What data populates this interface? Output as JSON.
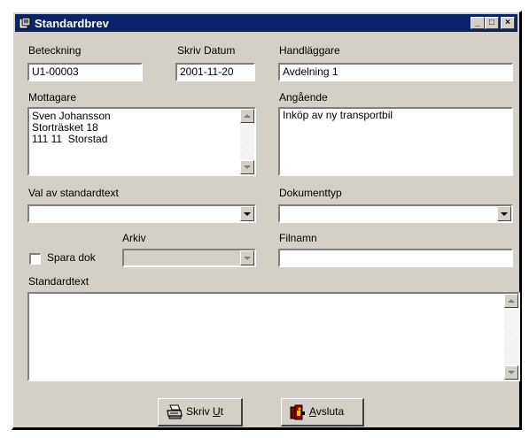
{
  "window": {
    "title": "Standardbrev",
    "minimize": "_",
    "maximize": "□",
    "close": "×"
  },
  "fields": {
    "beteckning": {
      "label": "Beteckning",
      "value": "U1-00003"
    },
    "skriv_datum": {
      "label": "Skriv Datum",
      "value": "2001-11-20"
    },
    "handlaggare": {
      "label": "Handläggare",
      "value": "Avdelning 1"
    },
    "mottagare": {
      "label": "Mottagare",
      "value": "Sven Johansson\nStorträsket 18\n111 11  Storstad"
    },
    "angaende": {
      "label": "Angående",
      "value": "Inköp av ny transportbil"
    },
    "val_av_standardtext": {
      "label": "Val av standardtext",
      "value": ""
    },
    "dokumenttyp": {
      "label": "Dokumenttyp",
      "value": ""
    },
    "spara_dok": {
      "label": "Spara dok",
      "checked": false
    },
    "arkiv": {
      "label": "Arkiv",
      "value": ""
    },
    "filnamn": {
      "label": "Filnamn",
      "value": ""
    },
    "standardtext": {
      "label": "Standardtext",
      "value": ""
    }
  },
  "buttons": {
    "skriv_ut": {
      "label_pre": "Skriv ",
      "label_ul": "U",
      "label_post": "t",
      "icon": "printer-icon"
    },
    "avsluta": {
      "label_pre": "",
      "label_ul": "A",
      "label_post": "vsluta",
      "icon": "exit-icon"
    }
  }
}
